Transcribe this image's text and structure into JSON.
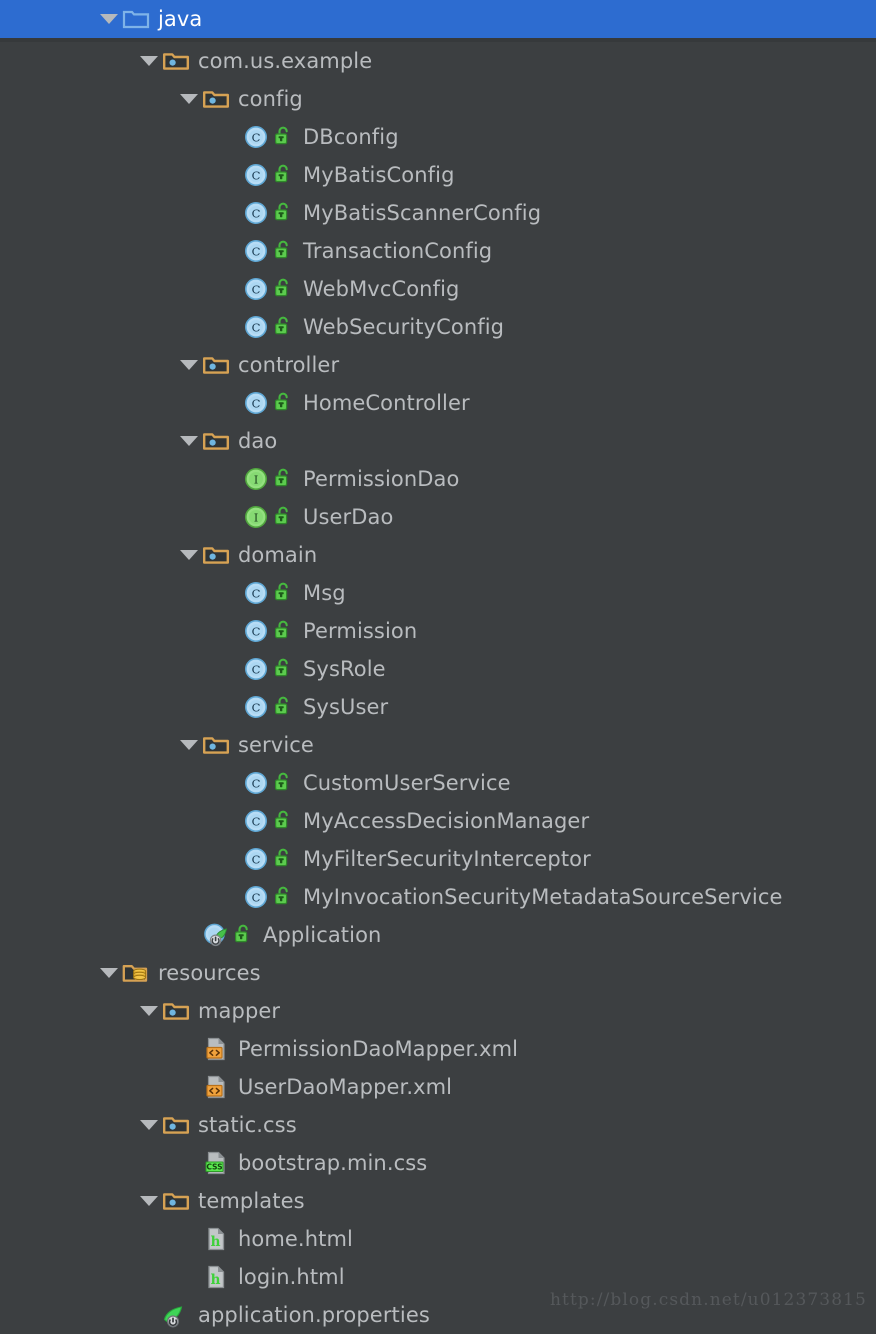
{
  "theme": {
    "background": "#3c3f41",
    "selection": "#2d6cd0",
    "text": "#b9bcbf",
    "selected_text": "#ffffff",
    "watermark_color": "#55585b"
  },
  "watermark": "http://blog.csdn.net/u012373815",
  "tree": [
    {
      "label": "java",
      "depth": 0,
      "icon": "source-folder-icon",
      "arrow": "expanded",
      "lock": false,
      "selected": true
    },
    {
      "label": "com.us.example",
      "depth": 1,
      "icon": "package-folder-icon",
      "arrow": "expanded",
      "lock": false,
      "selected": false
    },
    {
      "label": "config",
      "depth": 2,
      "icon": "package-folder-icon",
      "arrow": "expanded",
      "lock": false,
      "selected": false
    },
    {
      "label": "DBconfig",
      "depth": 3,
      "icon": "class-icon",
      "arrow": "none",
      "lock": true,
      "selected": false
    },
    {
      "label": "MyBatisConfig",
      "depth": 3,
      "icon": "class-icon",
      "arrow": "none",
      "lock": true,
      "selected": false
    },
    {
      "label": "MyBatisScannerConfig",
      "depth": 3,
      "icon": "class-icon",
      "arrow": "none",
      "lock": true,
      "selected": false
    },
    {
      "label": "TransactionConfig",
      "depth": 3,
      "icon": "class-icon",
      "arrow": "none",
      "lock": true,
      "selected": false
    },
    {
      "label": "WebMvcConfig",
      "depth": 3,
      "icon": "class-icon",
      "arrow": "none",
      "lock": true,
      "selected": false
    },
    {
      "label": "WebSecurityConfig",
      "depth": 3,
      "icon": "class-icon",
      "arrow": "none",
      "lock": true,
      "selected": false
    },
    {
      "label": "controller",
      "depth": 2,
      "icon": "package-folder-icon",
      "arrow": "expanded",
      "lock": false,
      "selected": false
    },
    {
      "label": "HomeController",
      "depth": 3,
      "icon": "class-icon",
      "arrow": "none",
      "lock": true,
      "selected": false
    },
    {
      "label": "dao",
      "depth": 2,
      "icon": "package-folder-icon",
      "arrow": "expanded",
      "lock": false,
      "selected": false
    },
    {
      "label": "PermissionDao",
      "depth": 3,
      "icon": "interface-icon",
      "arrow": "none",
      "lock": true,
      "selected": false
    },
    {
      "label": "UserDao",
      "depth": 3,
      "icon": "interface-icon",
      "arrow": "none",
      "lock": true,
      "selected": false
    },
    {
      "label": "domain",
      "depth": 2,
      "icon": "package-folder-icon",
      "arrow": "expanded",
      "lock": false,
      "selected": false
    },
    {
      "label": "Msg",
      "depth": 3,
      "icon": "class-icon",
      "arrow": "none",
      "lock": true,
      "selected": false
    },
    {
      "label": "Permission",
      "depth": 3,
      "icon": "class-icon",
      "arrow": "none",
      "lock": true,
      "selected": false
    },
    {
      "label": "SysRole",
      "depth": 3,
      "icon": "class-icon",
      "arrow": "none",
      "lock": true,
      "selected": false
    },
    {
      "label": "SysUser",
      "depth": 3,
      "icon": "class-icon",
      "arrow": "none",
      "lock": true,
      "selected": false
    },
    {
      "label": "service",
      "depth": 2,
      "icon": "package-folder-icon",
      "arrow": "expanded",
      "lock": false,
      "selected": false
    },
    {
      "label": "CustomUserService",
      "depth": 3,
      "icon": "class-icon",
      "arrow": "none",
      "lock": true,
      "selected": false
    },
    {
      "label": "MyAccessDecisionManager",
      "depth": 3,
      "icon": "class-icon",
      "arrow": "none",
      "lock": true,
      "selected": false
    },
    {
      "label": "MyFilterSecurityInterceptor",
      "depth": 3,
      "icon": "class-icon",
      "arrow": "none",
      "lock": true,
      "selected": false
    },
    {
      "label": "MyInvocationSecurityMetadataSourceService",
      "depth": 3,
      "icon": "class-icon",
      "arrow": "none",
      "lock": true,
      "selected": false
    },
    {
      "label": "Application",
      "depth": 2,
      "icon": "spring-boot-class-icon",
      "arrow": "none",
      "lock": true,
      "selected": false
    },
    {
      "label": "resources",
      "depth": 0,
      "icon": "resource-folder-icon",
      "arrow": "expanded",
      "lock": false,
      "selected": false
    },
    {
      "label": "mapper",
      "depth": 1,
      "icon": "package-folder-icon",
      "arrow": "expanded",
      "lock": false,
      "selected": false
    },
    {
      "label": "PermissionDaoMapper.xml",
      "depth": 2,
      "icon": "xml-file-icon",
      "arrow": "none",
      "lock": false,
      "selected": false
    },
    {
      "label": "UserDaoMapper.xml",
      "depth": 2,
      "icon": "xml-file-icon",
      "arrow": "none",
      "lock": false,
      "selected": false
    },
    {
      "label": "static.css",
      "depth": 1,
      "icon": "package-folder-icon",
      "arrow": "expanded",
      "lock": false,
      "selected": false
    },
    {
      "label": "bootstrap.min.css",
      "depth": 2,
      "icon": "css-file-icon",
      "arrow": "none",
      "lock": false,
      "selected": false
    },
    {
      "label": "templates",
      "depth": 1,
      "icon": "package-folder-icon",
      "arrow": "expanded",
      "lock": false,
      "selected": false
    },
    {
      "label": "home.html",
      "depth": 2,
      "icon": "html-file-icon",
      "arrow": "none",
      "lock": false,
      "selected": false
    },
    {
      "label": "login.html",
      "depth": 2,
      "icon": "html-file-icon",
      "arrow": "none",
      "lock": false,
      "selected": false
    },
    {
      "label": "application.properties",
      "depth": 1,
      "icon": "spring-properties-icon",
      "arrow": "none",
      "lock": false,
      "selected": false
    }
  ]
}
